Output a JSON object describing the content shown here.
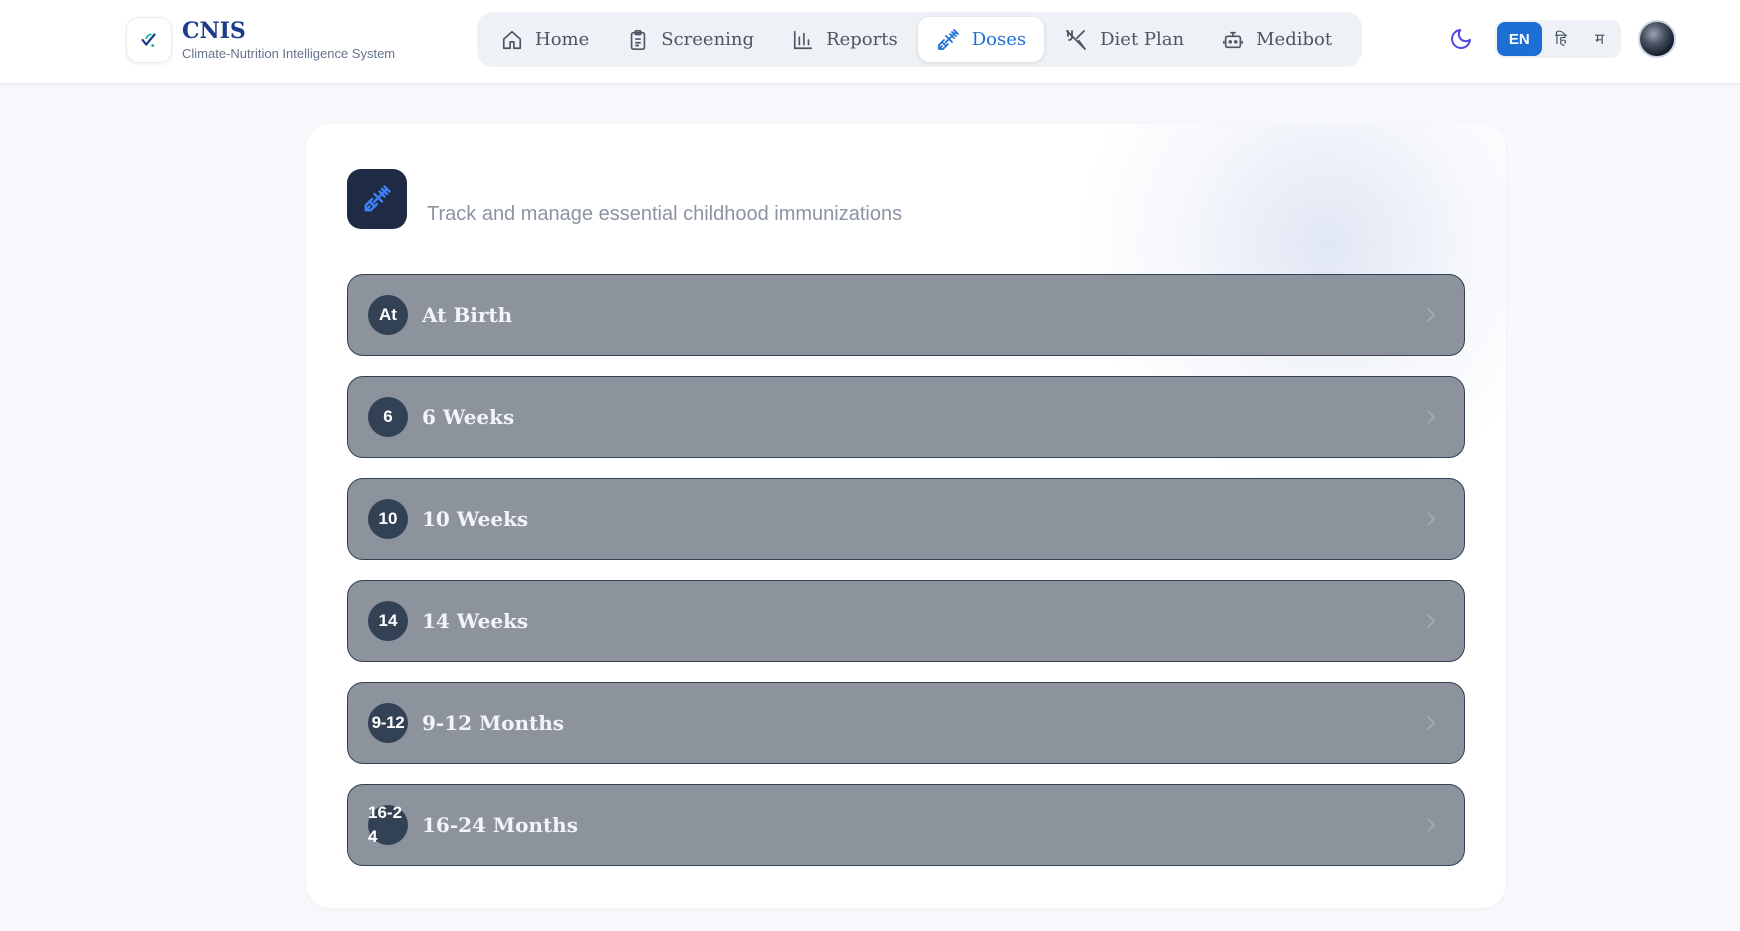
{
  "brand": {
    "title": "CNIS",
    "subtitle": "Climate-Nutrition Intelligence System",
    "logo_icon": "check-sprout-icon"
  },
  "nav": {
    "items": [
      {
        "label": "Home",
        "icon": "home-icon",
        "active": false
      },
      {
        "label": "Screening",
        "icon": "clipboard-icon",
        "active": false
      },
      {
        "label": "Reports",
        "icon": "bar-chart-icon",
        "active": false
      },
      {
        "label": "Doses",
        "icon": "syringe-icon",
        "active": true
      },
      {
        "label": "Diet Plan",
        "icon": "utensils-icon",
        "active": false
      },
      {
        "label": "Medibot",
        "icon": "bot-icon",
        "active": false
      }
    ]
  },
  "header_controls": {
    "theme_icon": "moon-icon",
    "languages": [
      "EN",
      "हि",
      "म"
    ],
    "active_language": "EN"
  },
  "colors": {
    "accent": "#1d6fd6",
    "brand": "#1e3a8a",
    "stage_bg": "#8d939d",
    "badge_bg": "#334155"
  },
  "card": {
    "icon": "syringe-icon",
    "subtitle": "Track and manage essential childhood immunizations"
  },
  "stages": [
    {
      "badge": "At",
      "label": "At Birth"
    },
    {
      "badge": "6",
      "label": "6 Weeks"
    },
    {
      "badge": "10",
      "label": "10 Weeks"
    },
    {
      "badge": "14",
      "label": "14 Weeks"
    },
    {
      "badge": "9-12",
      "label": "9-12 Months"
    },
    {
      "badge": "16-24",
      "label": "16-24 Months"
    }
  ]
}
